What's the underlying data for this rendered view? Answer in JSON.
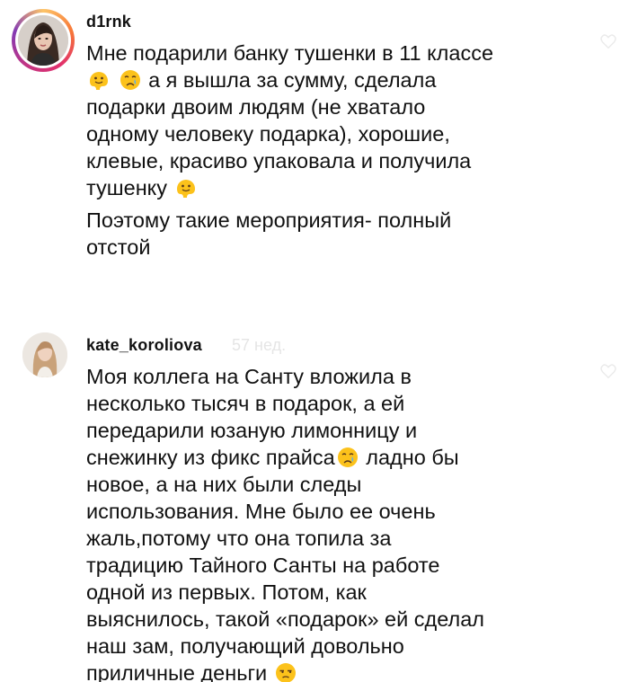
{
  "comments": [
    {
      "username": "d1rnk",
      "time": "",
      "avatar_icon": "user-avatar-photo",
      "lines": [
        "Мне подарили банку тушенки в 11 классе",
        "а я вышла за сумму, сделала",
        "подарки двоим людям (не хватало",
        "одному человеку подарка), хорошие,",
        "клевые, красиво упаковала и получила",
        "тушенку"
      ],
      "second_paragraph": [
        "Поэтому такие мероприятия- полный",
        "отстой"
      ],
      "emojis": [
        "melting-face-emoji",
        "crying-face-emoji"
      ]
    },
    {
      "username": "kate_koroliova",
      "time": "57 нед.",
      "avatar_icon": "user-avatar-photo",
      "lines": [
        "Моя коллега на Санту вложила в",
        "несколько тысяч в подарок, а ей",
        "передарили юзаную лимонницу и",
        "снежинку из фикс прайса",
        "ладно бы",
        "новое, а на них были следы",
        "использования. Мне было ее очень",
        "жаль,потому что она топила за",
        "традицию Тайного Санты на работе",
        "одной из первых. Потом, как",
        "выяснилось, такой «подарок» ей сделал",
        "наш зам, получающий довольно",
        "приличные деньги"
      ],
      "emojis": [
        "crying-face-emoji",
        "unamused-face-emoji"
      ]
    }
  ],
  "colors": {
    "text": "#111111",
    "faint": "#e5e5e5",
    "emoji_yellow": "#fcc21b",
    "tear_blue": "#5fb0e8"
  }
}
